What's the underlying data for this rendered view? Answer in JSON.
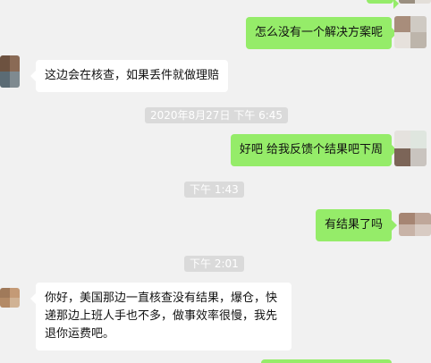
{
  "messages": [
    {
      "direction": "outgoing",
      "text": "怎么没有一个解决方案呢"
    },
    {
      "direction": "incoming",
      "text": "这边会在核查，如果丢件就做理赔"
    },
    {
      "direction": "outgoing",
      "text": "好吧 给我反馈个结果吧下周"
    },
    {
      "direction": "outgoing",
      "text": "有结果了吗"
    },
    {
      "direction": "incoming",
      "text": "你好，美国那边一直核查没有结果，爆仓，快递那边上班人手也不多，做事效率很慢，我先退你运费吧。"
    }
  ],
  "timestamps": [
    {
      "text": "2020年8月27日 下午 6:45"
    },
    {
      "text": "下午 1:43"
    },
    {
      "text": "下午 2:01"
    }
  ],
  "colors": {
    "outgoing_bubble": "#95ec69",
    "incoming_bubble": "#ffffff",
    "background": "#f1f1f1",
    "timestamp_bg": "#dadada"
  }
}
